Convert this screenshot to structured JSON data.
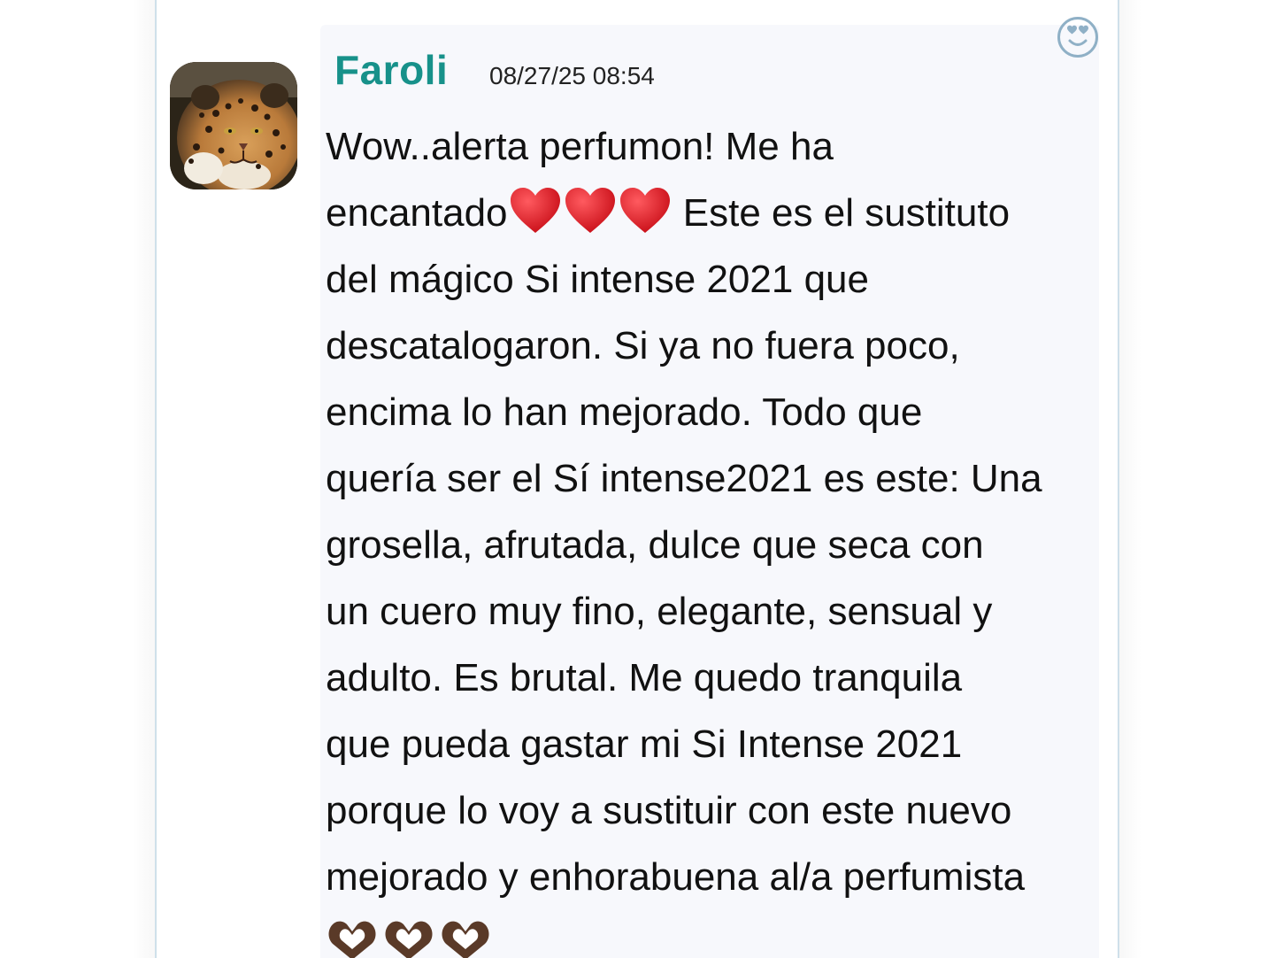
{
  "post": {
    "author": "Faroli",
    "timestamp": "08/27/25 08:54",
    "avatar_alt": "jaguar",
    "reaction_icon": "heart-eyes-face-icon",
    "message_lines": [
      "Wow..alerta perfumon! Me ha",
      "encantado",
      "Este es el sustituto",
      "del mágico Si intense 2021 que",
      "descatalogaron. Si ya no fuera poco,",
      "encima lo han mejorado. Todo que",
      "quería ser el Sí intense2021 es este: Una",
      "grosella, afrutada, dulce que seca con",
      "un cuero muy fino, elegante, sensual y",
      "adulto. Es brutal. Me quedo tranquila",
      "que pueda gastar mi Si Intense 2021",
      "porque lo voy a sustituir con este nuevo",
      "mejorado y enhorabuena al/a perfumista"
    ],
    "emoji": {
      "hearts": [
        "red-heart-icon",
        "red-heart-icon",
        "red-heart-icon"
      ],
      "hands": [
        "heart-hands-icon",
        "heart-hands-icon",
        "heart-hands-icon"
      ]
    },
    "colors": {
      "author": "#17918a",
      "heart": "#e0121c",
      "hands": "#5a3a28",
      "reaction_icon": "#8fb0c6"
    }
  }
}
